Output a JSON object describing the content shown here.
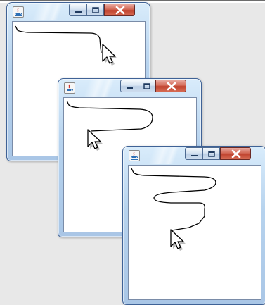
{
  "windows": [
    {
      "id": "window-1",
      "icon": "java-app-icon",
      "controls": [
        "minimize-icon",
        "maximize-icon",
        "close-icon"
      ],
      "cursor": "arrow-cursor-icon"
    },
    {
      "id": "window-2",
      "icon": "java-app-icon",
      "controls": [
        "minimize-icon",
        "maximize-icon",
        "close-icon"
      ],
      "cursor": "arrow-cursor-icon"
    },
    {
      "id": "window-3",
      "icon": "java-app-icon",
      "controls": [
        "minimize-icon",
        "maximize-icon",
        "close-icon"
      ],
      "cursor": "arrow-cursor-icon"
    }
  ],
  "colors": {
    "stroke": "#000000",
    "client_bg": "#ffffff",
    "close_red": "#c0432f",
    "frame_blue": "#b7d3ee"
  }
}
